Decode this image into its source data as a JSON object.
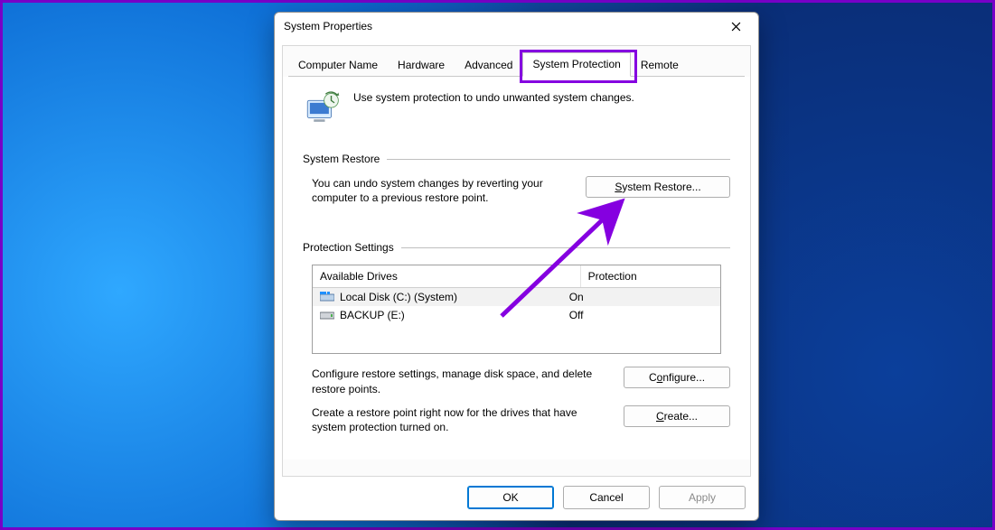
{
  "window": {
    "title": "System Properties"
  },
  "tabs": {
    "items": [
      {
        "label": "Computer Name"
      },
      {
        "label": "Hardware"
      },
      {
        "label": "Advanced"
      },
      {
        "label": "System Protection"
      },
      {
        "label": "Remote"
      }
    ],
    "active_index": 3
  },
  "intro": {
    "text": "Use system protection to undo unwanted system changes."
  },
  "restore_group": {
    "title": "System Restore",
    "desc": "You can undo system changes by reverting your computer to a previous restore point.",
    "button": "System Restore..."
  },
  "settings_group": {
    "title": "Protection Settings",
    "col_drive": "Available Drives",
    "col_prot": "Protection",
    "drives": [
      {
        "name": "Local Disk (C:) (System)",
        "protection": "On",
        "selected": true,
        "disk_style": "system"
      },
      {
        "name": "BACKUP (E:)",
        "protection": "Off",
        "selected": false,
        "disk_style": "ext"
      }
    ],
    "configure_desc": "Configure restore settings, manage disk space, and delete restore points.",
    "configure_btn": "Configure...",
    "create_desc": "Create a restore point right now for the drives that have system protection turned on.",
    "create_btn": "Create..."
  },
  "buttons": {
    "ok": "OK",
    "cancel": "Cancel",
    "apply": "Apply"
  }
}
